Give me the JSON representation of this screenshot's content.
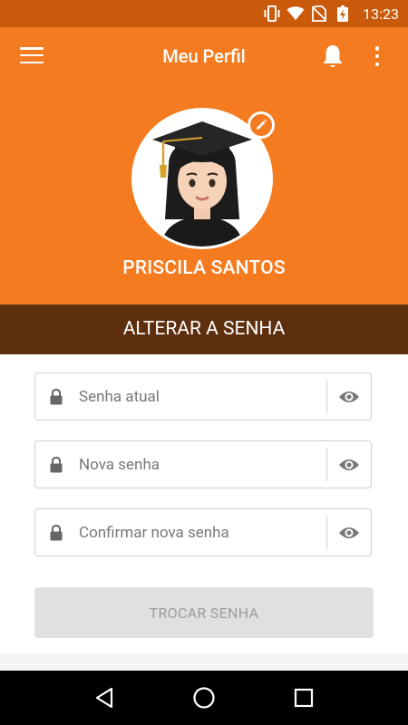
{
  "status_bar": {
    "time": "13:23"
  },
  "toolbar": {
    "title": "Meu Perfil"
  },
  "profile": {
    "name": "PRISCILA SANTOS"
  },
  "section": {
    "title": "ALTERAR A SENHA"
  },
  "form": {
    "current_password": {
      "placeholder": "Senha atual",
      "value": ""
    },
    "new_password": {
      "placeholder": "Nova senha",
      "value": ""
    },
    "confirm_password": {
      "placeholder": "Confirmar nova senha",
      "value": ""
    },
    "submit_label": "TROCAR SENHA"
  },
  "colors": {
    "primary": "#f47b20",
    "status_bar": "#c95a0c",
    "section_header": "#5e2f0e",
    "button_disabled": "#e0e0e0"
  },
  "icons": [
    "menu-icon",
    "bell-icon",
    "more-vert-icon",
    "edit-icon",
    "lock-icon",
    "eye-icon",
    "back-icon",
    "home-icon",
    "recents-icon",
    "vibrate-icon",
    "wifi-icon",
    "no-sim-icon",
    "battery-icon"
  ]
}
